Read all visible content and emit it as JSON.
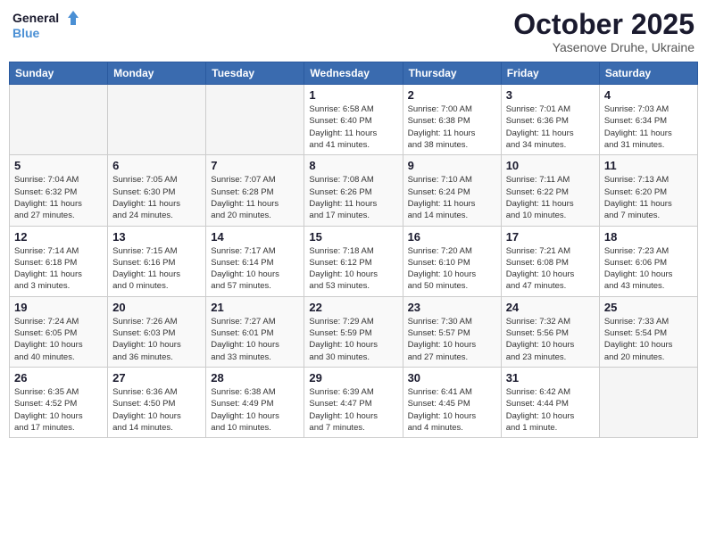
{
  "header": {
    "logo_line1": "General",
    "logo_line2": "Blue",
    "month": "October 2025",
    "location": "Yasenove Druhe, Ukraine"
  },
  "weekdays": [
    "Sunday",
    "Monday",
    "Tuesday",
    "Wednesday",
    "Thursday",
    "Friday",
    "Saturday"
  ],
  "weeks": [
    [
      {
        "num": "",
        "info": ""
      },
      {
        "num": "",
        "info": ""
      },
      {
        "num": "",
        "info": ""
      },
      {
        "num": "1",
        "info": "Sunrise: 6:58 AM\nSunset: 6:40 PM\nDaylight: 11 hours\nand 41 minutes."
      },
      {
        "num": "2",
        "info": "Sunrise: 7:00 AM\nSunset: 6:38 PM\nDaylight: 11 hours\nand 38 minutes."
      },
      {
        "num": "3",
        "info": "Sunrise: 7:01 AM\nSunset: 6:36 PM\nDaylight: 11 hours\nand 34 minutes."
      },
      {
        "num": "4",
        "info": "Sunrise: 7:03 AM\nSunset: 6:34 PM\nDaylight: 11 hours\nand 31 minutes."
      }
    ],
    [
      {
        "num": "5",
        "info": "Sunrise: 7:04 AM\nSunset: 6:32 PM\nDaylight: 11 hours\nand 27 minutes."
      },
      {
        "num": "6",
        "info": "Sunrise: 7:05 AM\nSunset: 6:30 PM\nDaylight: 11 hours\nand 24 minutes."
      },
      {
        "num": "7",
        "info": "Sunrise: 7:07 AM\nSunset: 6:28 PM\nDaylight: 11 hours\nand 20 minutes."
      },
      {
        "num": "8",
        "info": "Sunrise: 7:08 AM\nSunset: 6:26 PM\nDaylight: 11 hours\nand 17 minutes."
      },
      {
        "num": "9",
        "info": "Sunrise: 7:10 AM\nSunset: 6:24 PM\nDaylight: 11 hours\nand 14 minutes."
      },
      {
        "num": "10",
        "info": "Sunrise: 7:11 AM\nSunset: 6:22 PM\nDaylight: 11 hours\nand 10 minutes."
      },
      {
        "num": "11",
        "info": "Sunrise: 7:13 AM\nSunset: 6:20 PM\nDaylight: 11 hours\nand 7 minutes."
      }
    ],
    [
      {
        "num": "12",
        "info": "Sunrise: 7:14 AM\nSunset: 6:18 PM\nDaylight: 11 hours\nand 3 minutes."
      },
      {
        "num": "13",
        "info": "Sunrise: 7:15 AM\nSunset: 6:16 PM\nDaylight: 11 hours\nand 0 minutes."
      },
      {
        "num": "14",
        "info": "Sunrise: 7:17 AM\nSunset: 6:14 PM\nDaylight: 10 hours\nand 57 minutes."
      },
      {
        "num": "15",
        "info": "Sunrise: 7:18 AM\nSunset: 6:12 PM\nDaylight: 10 hours\nand 53 minutes."
      },
      {
        "num": "16",
        "info": "Sunrise: 7:20 AM\nSunset: 6:10 PM\nDaylight: 10 hours\nand 50 minutes."
      },
      {
        "num": "17",
        "info": "Sunrise: 7:21 AM\nSunset: 6:08 PM\nDaylight: 10 hours\nand 47 minutes."
      },
      {
        "num": "18",
        "info": "Sunrise: 7:23 AM\nSunset: 6:06 PM\nDaylight: 10 hours\nand 43 minutes."
      }
    ],
    [
      {
        "num": "19",
        "info": "Sunrise: 7:24 AM\nSunset: 6:05 PM\nDaylight: 10 hours\nand 40 minutes."
      },
      {
        "num": "20",
        "info": "Sunrise: 7:26 AM\nSunset: 6:03 PM\nDaylight: 10 hours\nand 36 minutes."
      },
      {
        "num": "21",
        "info": "Sunrise: 7:27 AM\nSunset: 6:01 PM\nDaylight: 10 hours\nand 33 minutes."
      },
      {
        "num": "22",
        "info": "Sunrise: 7:29 AM\nSunset: 5:59 PM\nDaylight: 10 hours\nand 30 minutes."
      },
      {
        "num": "23",
        "info": "Sunrise: 7:30 AM\nSunset: 5:57 PM\nDaylight: 10 hours\nand 27 minutes."
      },
      {
        "num": "24",
        "info": "Sunrise: 7:32 AM\nSunset: 5:56 PM\nDaylight: 10 hours\nand 23 minutes."
      },
      {
        "num": "25",
        "info": "Sunrise: 7:33 AM\nSunset: 5:54 PM\nDaylight: 10 hours\nand 20 minutes."
      }
    ],
    [
      {
        "num": "26",
        "info": "Sunrise: 6:35 AM\nSunset: 4:52 PM\nDaylight: 10 hours\nand 17 minutes."
      },
      {
        "num": "27",
        "info": "Sunrise: 6:36 AM\nSunset: 4:50 PM\nDaylight: 10 hours\nand 14 minutes."
      },
      {
        "num": "28",
        "info": "Sunrise: 6:38 AM\nSunset: 4:49 PM\nDaylight: 10 hours\nand 10 minutes."
      },
      {
        "num": "29",
        "info": "Sunrise: 6:39 AM\nSunset: 4:47 PM\nDaylight: 10 hours\nand 7 minutes."
      },
      {
        "num": "30",
        "info": "Sunrise: 6:41 AM\nSunset: 4:45 PM\nDaylight: 10 hours\nand 4 minutes."
      },
      {
        "num": "31",
        "info": "Sunrise: 6:42 AM\nSunset: 4:44 PM\nDaylight: 10 hours\nand 1 minute."
      },
      {
        "num": "",
        "info": ""
      }
    ]
  ]
}
